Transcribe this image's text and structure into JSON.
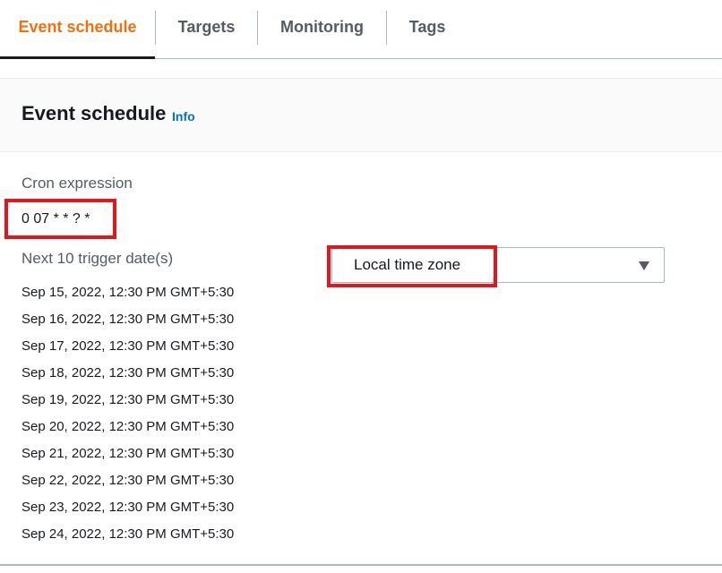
{
  "tabs": [
    {
      "label": "Event schedule",
      "active": true
    },
    {
      "label": "Targets",
      "active": false
    },
    {
      "label": "Monitoring",
      "active": false
    },
    {
      "label": "Tags",
      "active": false
    }
  ],
  "panel": {
    "title": "Event schedule",
    "info_link": "Info",
    "cron_label": "Cron expression",
    "cron_value": "0 07 * * ? *",
    "trigger_label": "Next 10 trigger date(s)",
    "trigger_dates": [
      "Sep 15, 2022, 12:30 PM GMT+5:30",
      "Sep 16, 2022, 12:30 PM GMT+5:30",
      "Sep 17, 2022, 12:30 PM GMT+5:30",
      "Sep 18, 2022, 12:30 PM GMT+5:30",
      "Sep 19, 2022, 12:30 PM GMT+5:30",
      "Sep 20, 2022, 12:30 PM GMT+5:30",
      "Sep 21, 2022, 12:30 PM GMT+5:30",
      "Sep 22, 2022, 12:30 PM GMT+5:30",
      "Sep 23, 2022, 12:30 PM GMT+5:30",
      "Sep 24, 2022, 12:30 PM GMT+5:30"
    ],
    "timezone_select": {
      "value": "Local time zone",
      "icon": "caret-down-icon"
    }
  },
  "colors": {
    "active_tab": "#ec7211",
    "link": "#0073bb",
    "highlight_box": "#e3161e"
  }
}
